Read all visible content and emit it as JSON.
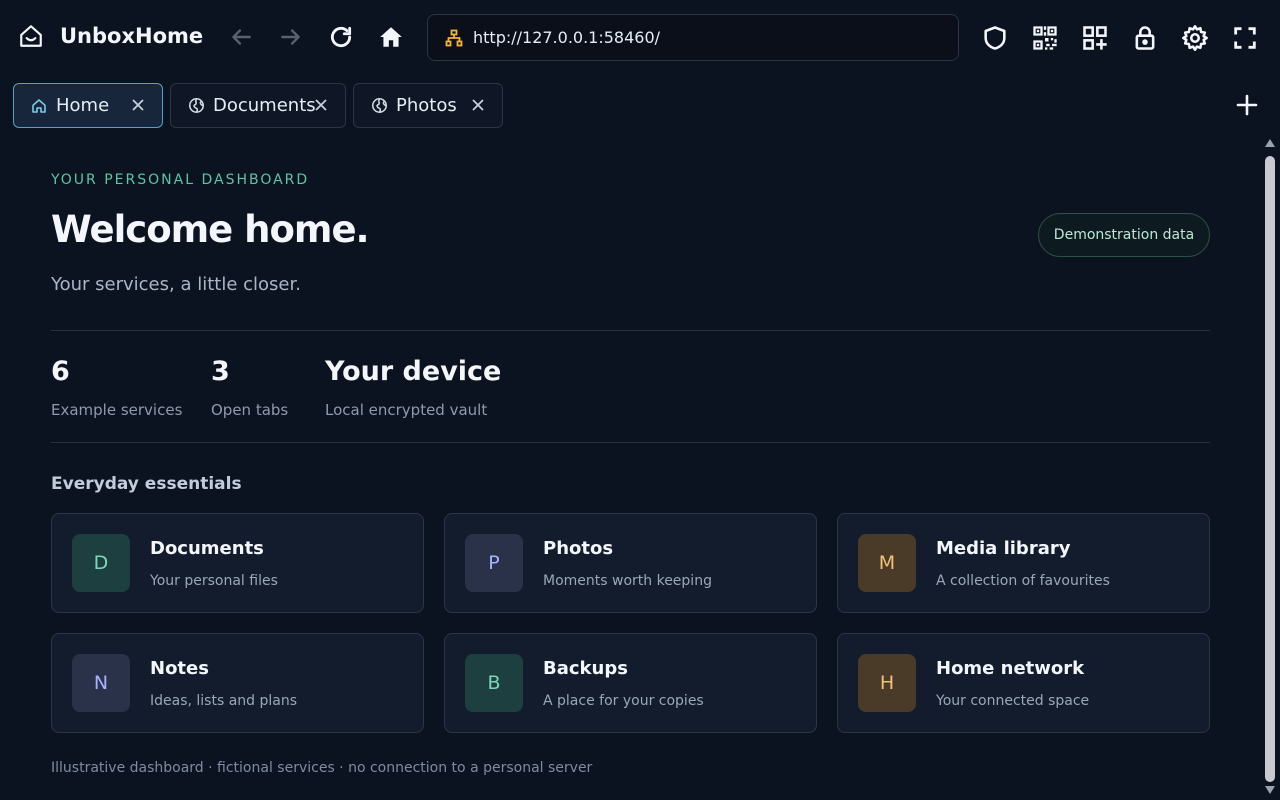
{
  "app": {
    "name": "UnboxHome"
  },
  "address_bar": {
    "url": "http://127.0.0.1:58460/"
  },
  "tabs": [
    {
      "label": "Home",
      "icon": "home-icon",
      "active": true
    },
    {
      "label": "Documents",
      "icon": "globe-icon",
      "active": false
    },
    {
      "label": "Photos",
      "icon": "globe-icon",
      "active": false
    }
  ],
  "main": {
    "eyebrow": "YOUR PERSONAL DASHBOARD",
    "title": "Welcome home.",
    "subtitle": "Your services, a little closer.",
    "demo_badge": "Demonstration data",
    "stats": [
      {
        "value": "6",
        "label": "Example services"
      },
      {
        "value": "3",
        "label": "Open tabs"
      },
      {
        "value": "Your device",
        "label": "Local encrypted vault"
      }
    ],
    "section_title": "Everyday essentials",
    "services": [
      {
        "letter": "D",
        "title": "Documents",
        "subtitle": "Your personal files"
      },
      {
        "letter": "P",
        "title": "Photos",
        "subtitle": "Moments worth keeping"
      },
      {
        "letter": "M",
        "title": "Media library",
        "subtitle": "A collection of favourites"
      },
      {
        "letter": "N",
        "title": "Notes",
        "subtitle": "Ideas, lists and plans"
      },
      {
        "letter": "B",
        "title": "Backups",
        "subtitle": "A place for your copies"
      },
      {
        "letter": "H",
        "title": "Home network",
        "subtitle": "Your connected space"
      }
    ],
    "footer": "Illustrative dashboard · fictional services · no connection to a personal server"
  },
  "colors": {
    "background": "#0b1220",
    "accent_green": "#5fc4a2",
    "accent_blue": "#4ea3c8",
    "badge_teal_bg": "#1d3f3f",
    "badge_teal_fg": "#7dd6b7",
    "badge_slate_bg": "#2a3249",
    "badge_slate_fg": "#a8b3ff",
    "badge_amber_bg": "#4a3a28",
    "badge_amber_fg": "#f0c27a"
  }
}
